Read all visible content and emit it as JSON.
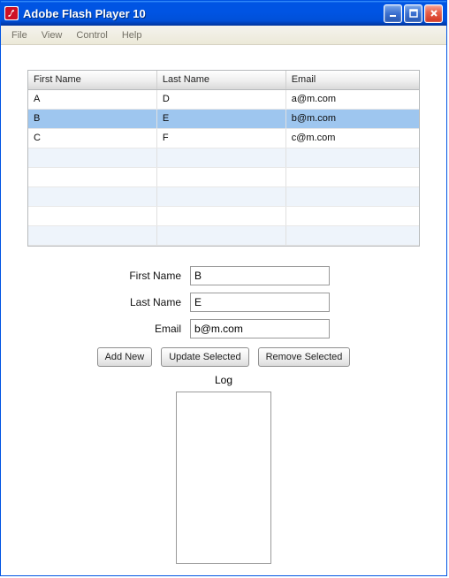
{
  "window": {
    "title": "Adobe Flash Player 10"
  },
  "menubar": {
    "items": [
      "File",
      "View",
      "Control",
      "Help"
    ]
  },
  "table": {
    "headers": {
      "first": "First Name",
      "last": "Last Name",
      "email": "Email"
    },
    "rows": [
      {
        "first": "A",
        "last": "D",
        "email": "a@m.com",
        "selected": false
      },
      {
        "first": "B",
        "last": "E",
        "email": "b@m.com",
        "selected": true
      },
      {
        "first": "C",
        "last": "F",
        "email": "c@m.com",
        "selected": false
      }
    ],
    "visibleRows": 8
  },
  "form": {
    "labels": {
      "first": "First Name",
      "last": "Last Name",
      "email": "Email"
    },
    "values": {
      "first": "B",
      "last": "E",
      "email": "b@m.com"
    }
  },
  "buttons": {
    "add": "Add New",
    "update": "Update Selected",
    "remove": "Remove Selected"
  },
  "log": {
    "label": "Log",
    "content": ""
  }
}
